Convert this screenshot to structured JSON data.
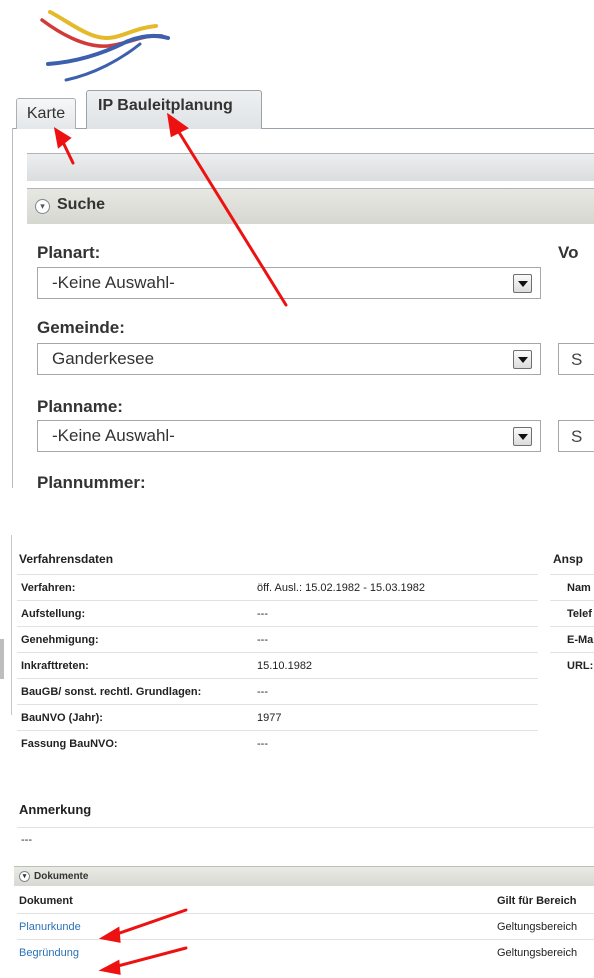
{
  "tabs": [
    {
      "label": "Karte"
    },
    {
      "label": "IP Bauleitplanung"
    }
  ],
  "search": {
    "title": "Suche",
    "fields": [
      {
        "label": "Planart:",
        "value": "-Keine Auswahl-"
      },
      {
        "label": "Gemeinde:",
        "value": "Ganderkesee"
      },
      {
        "label": "Planname:",
        "value": "-Keine Auswahl-"
      },
      {
        "label": "Plannummer:"
      }
    ],
    "right_label": "Vo",
    "right_boxes": [
      "S",
      "S"
    ]
  },
  "verfahrensdaten": {
    "title": "Verfahrensdaten",
    "rows": [
      {
        "key": "Verfahren:",
        "value": "öff. Ausl.: 15.02.1982 - 15.03.1982"
      },
      {
        "key": "Aufstellung:",
        "value": "---"
      },
      {
        "key": "Genehmigung:",
        "value": "---"
      },
      {
        "key": "Inkrafttreten:",
        "value": "15.10.1982"
      },
      {
        "key": "BauGB/ sonst. rechtl. Grundlagen:",
        "value": "---"
      },
      {
        "key": "BauNVO (Jahr):",
        "value": "1977"
      },
      {
        "key": "Fassung BauNVO:",
        "value": "---"
      }
    ]
  },
  "ansprechpartner": {
    "title": "Ansp",
    "rows": [
      "Nam",
      "Telef",
      "E-Ma",
      "URL:"
    ]
  },
  "anmerkung": {
    "title": "Anmerkung",
    "value": "---"
  },
  "dokumente": {
    "title": "Dokumente",
    "headers": [
      "Dokument",
      "Gilt für Bereich"
    ],
    "rows": [
      {
        "name": "Planurkunde",
        "bereich": "Geltungsbereich"
      },
      {
        "name": "Begründung",
        "bereich": "Geltungsbereich"
      }
    ]
  },
  "colors": {
    "arrow": "#ee1111",
    "link": "#2a72b5"
  }
}
